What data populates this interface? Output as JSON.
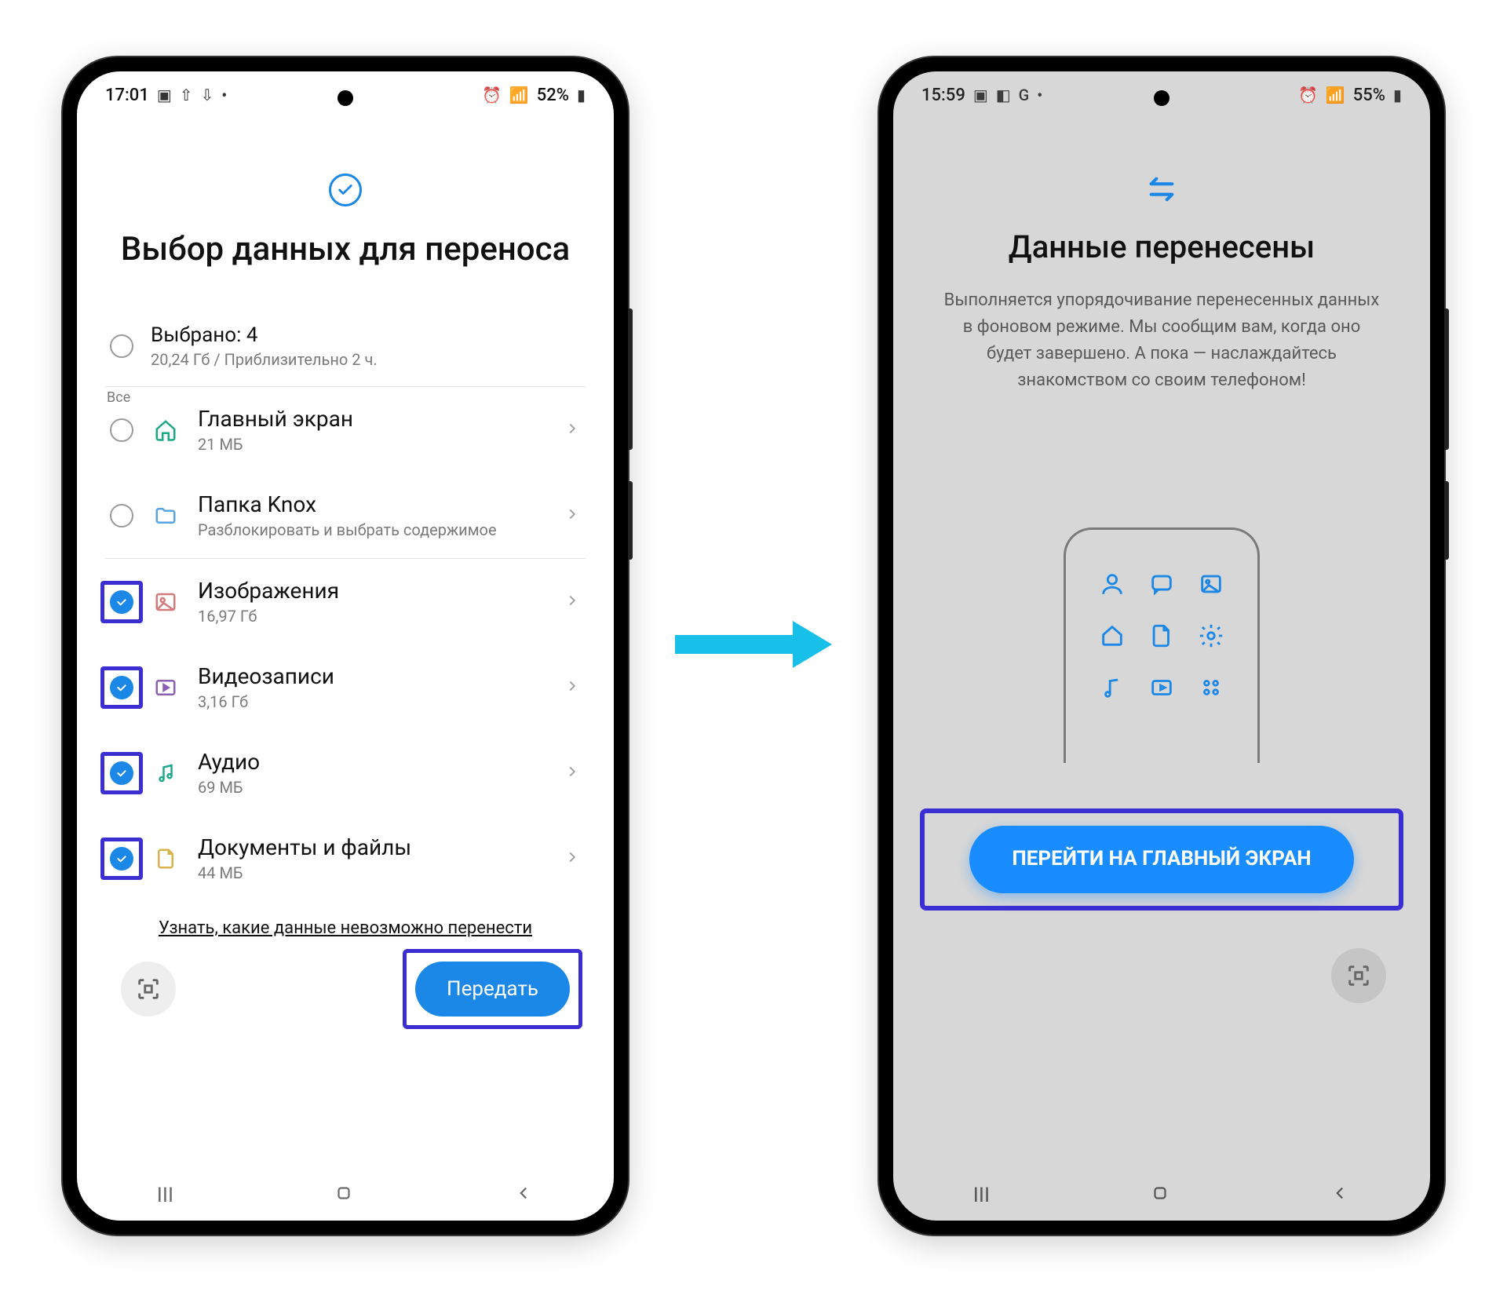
{
  "colors": {
    "accent": "#1b87e6",
    "highlight": "#3b2fd3",
    "arrow": "#18bfe8"
  },
  "phone1": {
    "status": {
      "time": "17:01",
      "battery": "52%"
    },
    "title": "Выбор данных для переноса",
    "select_all": {
      "label": "Все",
      "line1": "Выбрано: 4",
      "line2": "20,24 Гб / Приблизительно 2 ч."
    },
    "items": [
      {
        "name": "Главный экран",
        "sub": "21 МБ",
        "checked": false,
        "icon": "home",
        "highlight": false
      },
      {
        "name": "Папка Knox",
        "sub": "Разблокировать и выбрать содержимое",
        "checked": false,
        "icon": "folder",
        "highlight": false
      },
      {
        "name": "Изображения",
        "sub": "16,97 Гб",
        "checked": true,
        "icon": "image",
        "highlight": true
      },
      {
        "name": "Видеозаписи",
        "sub": "3,16 Гб",
        "checked": true,
        "icon": "video",
        "highlight": true
      },
      {
        "name": "Аудио",
        "sub": "69 МБ",
        "checked": true,
        "icon": "audio",
        "highlight": true
      },
      {
        "name": "Документы и файлы",
        "sub": "44 МБ",
        "checked": true,
        "icon": "document",
        "highlight": true
      }
    ],
    "cannot_transfer_link": "Узнать, какие данные невозможно перенести",
    "transfer_button": "Передать"
  },
  "phone2": {
    "status": {
      "time": "15:59",
      "battery": "55%"
    },
    "title": "Данные перенесены",
    "description": "Выполняется упорядочивание перенесенных данных в фоновом режиме. Мы сообщим вам, когда оно будет завершено. А пока — наслаждайтесь знакомством со своим телефоном!",
    "cta": "ПЕРЕЙТИ НА ГЛАВНЫЙ ЭКРАН"
  }
}
